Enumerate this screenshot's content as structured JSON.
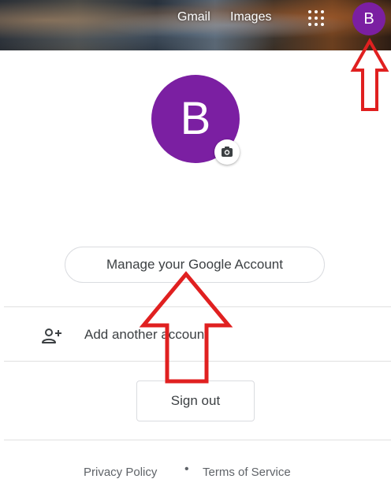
{
  "topbar": {
    "gmail_label": "Gmail",
    "images_label": "Images",
    "apps_icon": "apps-grid-icon",
    "avatar_initial": "B"
  },
  "account": {
    "avatar_initial": "B",
    "avatar_color": "#7b1fa2",
    "camera_icon": "camera-icon",
    "manage_label": "Manage your Google Account"
  },
  "menu": {
    "add_account_icon": "add-person-icon",
    "add_account_label": "Add another account",
    "sign_out_label": "Sign out"
  },
  "footer": {
    "privacy_label": "Privacy Policy",
    "separator": "•",
    "terms_label": "Terms of Service"
  },
  "annotations": {
    "arrow_color": "#e02020"
  }
}
